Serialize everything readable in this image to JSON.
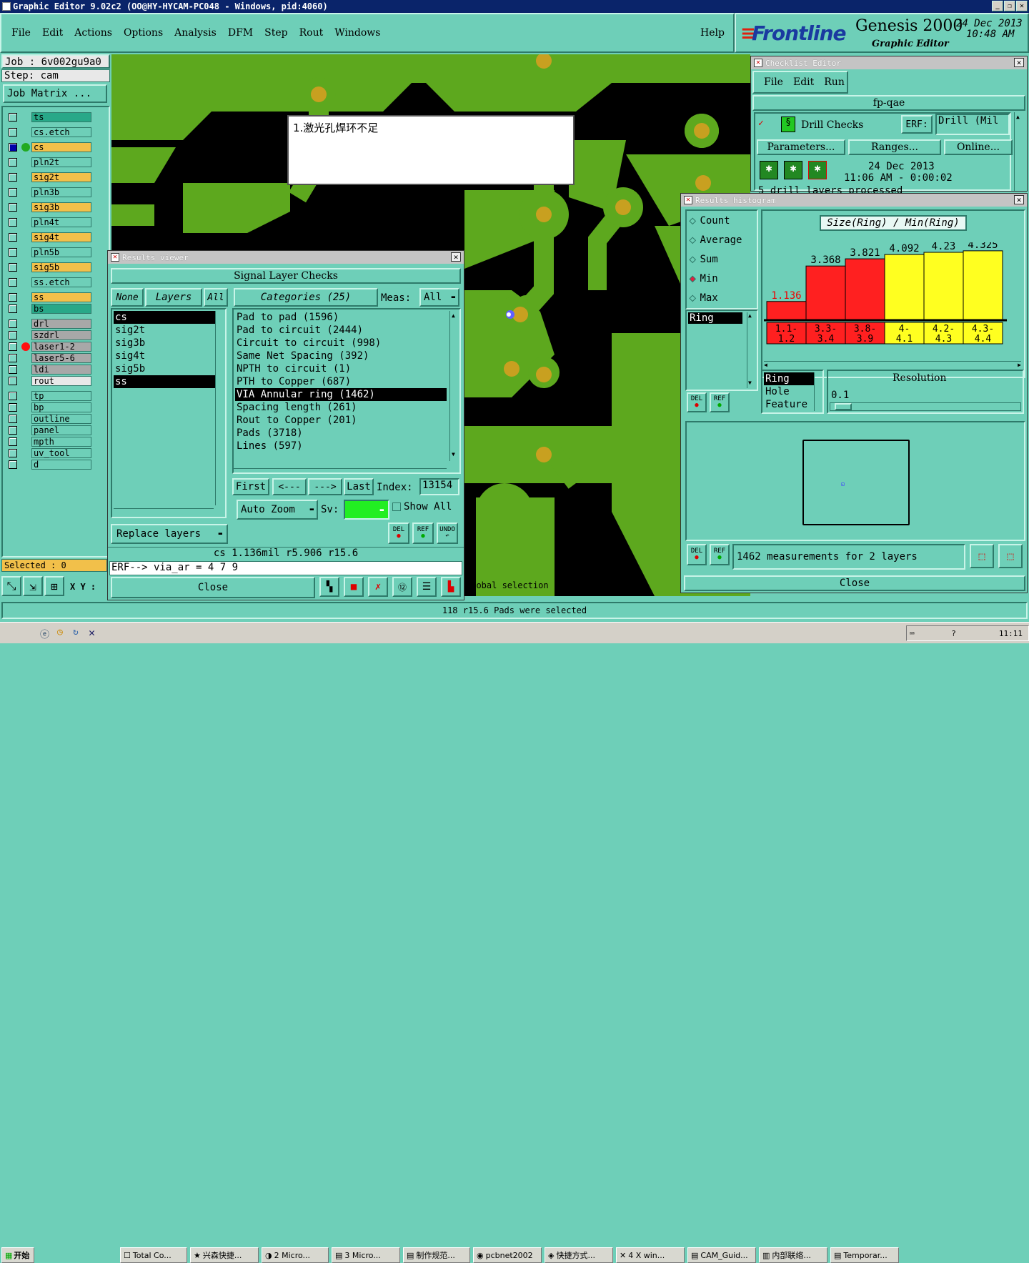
{
  "window": {
    "title": "Graphic Editor 9.02c2 (OO@HY-HYCAM-PC048 - Windows, pid:4060)"
  },
  "menu": [
    "File",
    "Edit",
    "Actions",
    "Options",
    "Analysis",
    "DFM",
    "Step",
    "Rout",
    "Windows"
  ],
  "help_label": "Help",
  "brand": {
    "logo": "Frontline",
    "product": "Genesis 2000",
    "subtitle": "Graphic Editor",
    "date": "24 Dec 2013",
    "time": "10:48 AM"
  },
  "job": {
    "job_label": "Job  :  6v002gu9a0",
    "step_label": "Step:  cam",
    "matrix_button": "Job Matrix ..."
  },
  "layers": [
    "ts",
    "cs.etch",
    "cs",
    "pln2t",
    "sig2t",
    "pln3b",
    "sig3b",
    "pln4t",
    "sig4t",
    "pln5b",
    "sig5b",
    "ss.etch",
    "ss",
    "bs",
    "drl",
    "szdrl",
    "laser1-2",
    "laser5-6",
    "ldi",
    "rout",
    "tp",
    "bp",
    "outline",
    "panel",
    "mpth",
    "uv_tool",
    "d"
  ],
  "selected_label": "Selected : 0",
  "xy_label": "X Y :",
  "note": "1.激光孔焊环不足",
  "global_selection": "Global selection",
  "status": "118 r15.6 Pads were selected",
  "results_viewer": {
    "title": "Results viewer",
    "header": "Signal Layer Checks",
    "none_btn": "None",
    "layers_btn": "Layers",
    "all_btn": "All",
    "categories_btn": "Categories (25)",
    "meas_label": "Meas:",
    "meas_value": "All",
    "layer_list": [
      "cs",
      "sig2t",
      "sig3b",
      "sig4t",
      "sig5b",
      "ss"
    ],
    "categories": [
      "Pad to pad (1596)",
      "Pad to circuit (2444)",
      "Circuit to circuit (998)",
      "Same Net Spacing (392)",
      "NPTH to circuit (1)",
      "PTH to Copper (687)",
      "VIA Annular ring (1462)",
      "Spacing length (261)",
      "Rout to Copper (201)",
      "Pads (3718)",
      "Lines (597)"
    ],
    "first_btn": "First",
    "prev_btn": "<---",
    "next_btn": "--->",
    "last_btn": "Last",
    "index_label": "Index:",
    "index_value": "13154",
    "replace_btn": "Replace layers",
    "zoom_btn": "Auto Zoom",
    "sv_label": "Sv:",
    "show_all": "Show All",
    "del_btn": "DEL",
    "ref_btn": "REF",
    "undo_btn": "UNDO",
    "info_line": "cs 1.136mil  r5.906  r15.6",
    "erf_line": "ERF--> via_ar = 4 7 9",
    "close_btn": "Close"
  },
  "checklist": {
    "title": "Checklist Editor",
    "menu": [
      "File",
      "Edit",
      "Run"
    ],
    "name": "fp-qae",
    "check_name": "Drill Checks",
    "erf_label": "ERF:",
    "erf_value": "Drill (Mil",
    "params_btn": "Parameters...",
    "ranges_btn": "Ranges...",
    "online_btn": "Online...",
    "date": "24 Dec 2013",
    "time": "11:06 AM - 0:00:02",
    "status": "5 drill layers processed"
  },
  "histogram": {
    "title": "Results histogram",
    "options": [
      "Count",
      "Average",
      "Sum",
      "Min",
      "Max"
    ],
    "selected_option": "Min",
    "chart_title": "Size(Ring) / Min(Ring)",
    "list_top": [
      "Ring"
    ],
    "list_bottom": [
      "Ring",
      "Hole",
      "Feature"
    ],
    "resolution_label": "Resolution",
    "resolution_value": "0.1",
    "summary": "1462 measurements for 2 layers",
    "del_btn": "DEL",
    "ref_btn": "REF",
    "close_btn": "Close"
  },
  "chart_data": {
    "type": "bar",
    "categories": [
      "1.1-1.2",
      "3.3-3.4",
      "3.8-3.9",
      "4-4.1",
      "4.2-4.3",
      "4.3-4.4"
    ],
    "values": [
      1.136,
      3.368,
      3.821,
      4.092,
      4.23,
      4.325
    ],
    "value_labels": [
      "1.136",
      "3.368",
      "3.821",
      "4.092",
      "4.23",
      "4.325"
    ],
    "category_labels": [
      [
        "1.1-",
        "1.2"
      ],
      [
        "3.3-",
        "3.4"
      ],
      [
        "3.8-",
        "3.9"
      ],
      [
        "4-",
        "4.1"
      ],
      [
        "4.2-",
        "4.3"
      ],
      [
        "4.3-",
        "4.4"
      ]
    ],
    "colors": [
      "#ff2020",
      "#ff2020",
      "#ff2020",
      "#ffff20",
      "#ffff20",
      "#ffff20"
    ],
    "title": "Size(Ring) / Min(Ring)",
    "ylim": [
      0,
      4.5
    ]
  },
  "taskbar": {
    "start": "开始",
    "items": [
      "Total Co...",
      "兴森快捷...",
      "2 Micro...",
      "3 Micro...",
      "制作规范...",
      "pcbnet2002",
      "快捷方式...",
      "4 X win...",
      "CAM_Guid...",
      "内部联络...",
      "Temporar..."
    ],
    "clock": "11:11"
  },
  "colors": {
    "panel": "#6ecfb8",
    "board_green": "#5da81e",
    "board_black": "#000000",
    "pad": "#c8a020"
  }
}
